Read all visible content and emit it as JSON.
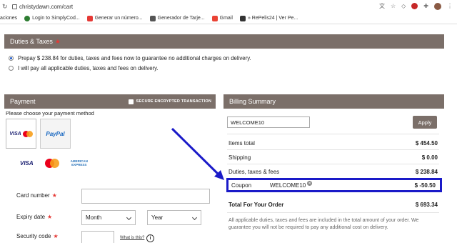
{
  "browser": {
    "url": "christydawn.com/cart",
    "bookmarks": [
      {
        "label": "aciones",
        "color": "#ffffff"
      },
      {
        "label": "Login to SimplyCod...",
        "color": "#2e7d32"
      },
      {
        "label": "Generar un número...",
        "color": "#e53935"
      },
      {
        "label": "Generador de Tarje...",
        "color": "#555555"
      },
      {
        "label": "Gmail",
        "color": "#ea4335"
      },
      {
        "label": "» RePelis24 | Ver Pe...",
        "color": "#333333"
      }
    ]
  },
  "duties": {
    "title": "Duties & Taxes",
    "required_mark": "★",
    "option_prepay": "Prepay $ 238.84 for duties, taxes and fees now to guarantee no additional charges on delivery.",
    "option_later": "I will pay all applicable duties, taxes and fees on delivery."
  },
  "payment": {
    "title": "Payment",
    "secure_label": "SECURE ENCRYPTED TRANSACTION",
    "choose_label": "Please choose your payment method",
    "tile_visa": "VISA",
    "tile_paypal": "PayPal",
    "logo_visa": "VISA",
    "logo_amex_line1": "AMERICAN",
    "logo_amex_line2": "EXPRESS",
    "card_number_label": "Card number",
    "expiry_label": "Expiry date",
    "month_placeholder": "Month",
    "year_placeholder": "Year",
    "security_label": "Security code",
    "what_is_this": "What is this?",
    "required_mark": "★"
  },
  "billing": {
    "title": "Billing Summary",
    "promo_value": "WELCOME10",
    "apply_label": "Apply",
    "items_total_label": "Items total",
    "items_total_value": "$ 454.50",
    "shipping_label": "Shipping",
    "shipping_value": "$ 0.00",
    "duties_label": "Duties, taxes & fees",
    "duties_value": "$ 238.84",
    "coupon_label": "Coupon",
    "coupon_code": "WELCOME10",
    "coupon_value": "$ -50.50",
    "total_label": "Total For Your Order",
    "total_value": "$ 693.34",
    "note": "All applicable duties, taxes and fees are included in the total amount of your order. We guarantee you will not be required to pay any additional cost on delivery."
  },
  "colors": {
    "header_bg": "#7b6f69",
    "annotation_blue": "#1a1ac8",
    "required_red": "#e53935"
  }
}
